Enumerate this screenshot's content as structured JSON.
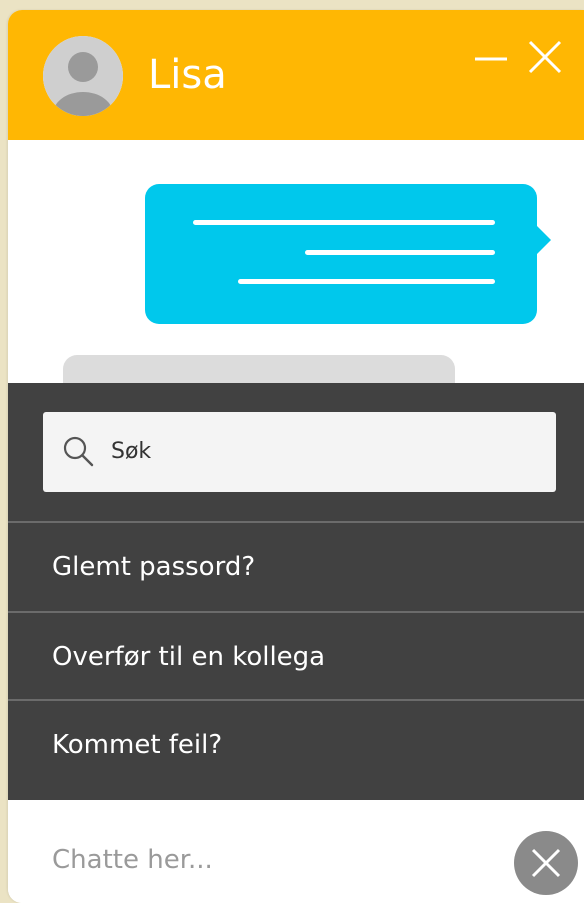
{
  "header": {
    "contact_name": "Lisa",
    "icons": {
      "avatar": "user-avatar-icon",
      "minimize": "minimize-icon",
      "close": "close-icon"
    }
  },
  "colors": {
    "header": "#ffb703",
    "outgoing_bubble": "#00c8ec",
    "incoming_bubble": "#dcdcdc",
    "menu_background": "#414141",
    "close_button": "#8a8a8a"
  },
  "quick_menu": {
    "search": {
      "value": "Søk"
    },
    "items": [
      {
        "label": "Glemt passord?"
      },
      {
        "label": "Overfør til en kollega"
      },
      {
        "label": "Kommet feil?"
      }
    ]
  },
  "composer": {
    "placeholder": "Chatte her..."
  }
}
